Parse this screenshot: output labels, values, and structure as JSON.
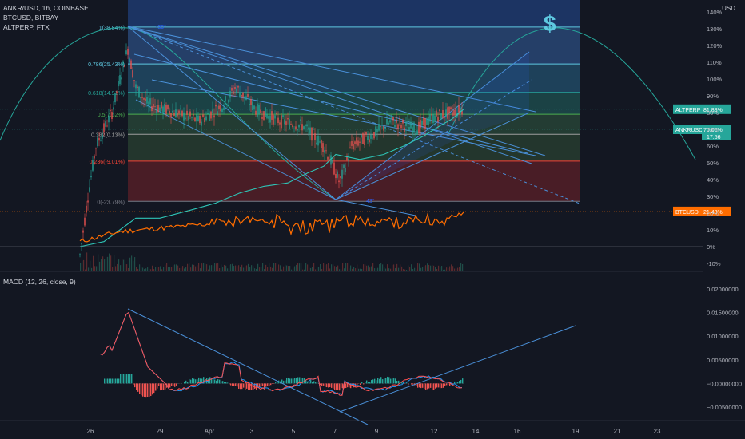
{
  "legend": {
    "main": "ANKR/USD, 1h, COINBASE",
    "compare1": "BTCUSD, BITBAY",
    "compare2": "ALTPERP, FTX",
    "macd": "MACD (12, 26, close, 9)"
  },
  "currency": "USD",
  "dollar_sign": "$",
  "colors": {
    "background": "#131722",
    "ankr_up": "#26a69a",
    "ankr_down": "#ef5350",
    "btc": "#ff6d00",
    "altperp": "#2ec4b6",
    "trend": "#2962ff",
    "fib_line": "#5ec8e0",
    "macd_line": "#2196f3",
    "signal_line": "#ff5252",
    "hist_up": "#26a69a",
    "hist_down": "#ef5350",
    "sine": "#26a69a"
  },
  "fib_levels": [
    {
      "label": "1(38.84%)",
      "pct": 131,
      "color": "#5ec8e0"
    },
    {
      "label": "0.786(25.43%)",
      "pct": 109,
      "color": "#5ec8e0"
    },
    {
      "label": "0.618(14.91%)",
      "pct": 92,
      "color": "#26a69a"
    },
    {
      "label": "0.5(7.52%)",
      "pct": 79,
      "color": "#4caf50"
    },
    {
      "label": "0.382(0.13%)",
      "pct": 67,
      "color": "#9e9e9e"
    },
    {
      "label": "0.236(-9.01%)",
      "pct": 51,
      "color": "#f44336"
    },
    {
      "label": "0(-23.79%)",
      "pct": 27,
      "color": "#787b86"
    }
  ],
  "angle_labels": {
    "top": "-30°",
    "bottom": "43°"
  },
  "price_ticks": [
    "140%",
    "130%",
    "120%",
    "110%",
    "100%",
    "90%",
    "80%",
    "70%",
    "60%",
    "50%",
    "40%",
    "30%",
    "20%",
    "10%",
    "0%",
    "-10%"
  ],
  "price_tick_values": [
    140,
    130,
    120,
    110,
    100,
    90,
    80,
    70,
    60,
    50,
    40,
    30,
    20,
    10,
    0,
    -10
  ],
  "macd_ticks": [
    "0.02000000",
    "0.01500000",
    "0.01000000",
    "0.00500000",
    "−0.00000000",
    "−0.00500000"
  ],
  "macd_tick_values": [
    0.02,
    0.015,
    0.01,
    0.005,
    0,
    -0.005
  ],
  "x_ticks": [
    "26",
    "29",
    "Apr",
    "3",
    "5",
    "7",
    "9",
    "12",
    "14",
    "16",
    "19",
    "21",
    "23"
  ],
  "price_badges": {
    "altperp": {
      "label": "ALTPERP",
      "value": "81.88%",
      "pct": 82
    },
    "ankr": {
      "label": "ANKRUSD",
      "value": "70.05%",
      "sub": "17:56",
      "pct": 70
    },
    "btc": {
      "label": "BTCUSD",
      "value": "21.48%",
      "pct": 21
    }
  },
  "chart_data": {
    "type": "line",
    "title": "ANKR/USD, 1h, COINBASE",
    "series": [
      {
        "name": "ANKR/USD",
        "x": [
          "26",
          "28",
          "29",
          "Apr",
          "3",
          "5",
          "7",
          "9",
          "12",
          "13"
        ],
        "values": [
          -5,
          115,
          85,
          72,
          90,
          68,
          45,
          65,
          75,
          82
        ]
      },
      {
        "name": "BTCUSD, BITBAY",
        "x": [
          "26",
          "28",
          "29",
          "Apr",
          "3",
          "5",
          "7",
          "9",
          "12",
          "13"
        ],
        "values": [
          3,
          7,
          10,
          14,
          15,
          12,
          10,
          15,
          16,
          21
        ]
      },
      {
        "name": "ALTPERP, FTX",
        "x": [
          "26",
          "28",
          "29",
          "Apr",
          "3",
          "5",
          "7",
          "9",
          "12",
          "13"
        ],
        "values": [
          0,
          2,
          18,
          22,
          30,
          35,
          45,
          55,
          70,
          82
        ]
      }
    ],
    "macd": {
      "name": "MACD (12, 26, close, 9)",
      "x": [
        "26",
        "27",
        "28",
        "29",
        "Apr",
        "3",
        "5",
        "7",
        "9",
        "12",
        "13"
      ],
      "macd": [
        0.006,
        0.007,
        0.0155,
        0.002,
        0.0,
        0.004,
        -0.001,
        -0.003,
        0.003,
        0.0,
        0.001
      ],
      "signal": [
        0.005,
        0.006,
        0.014,
        0.003,
        0.0005,
        0.003,
        0.0,
        -0.002,
        0.002,
        0.0005,
        0.0008
      ]
    },
    "ylim": [
      -12,
      145
    ],
    "ylabel": ""
  }
}
